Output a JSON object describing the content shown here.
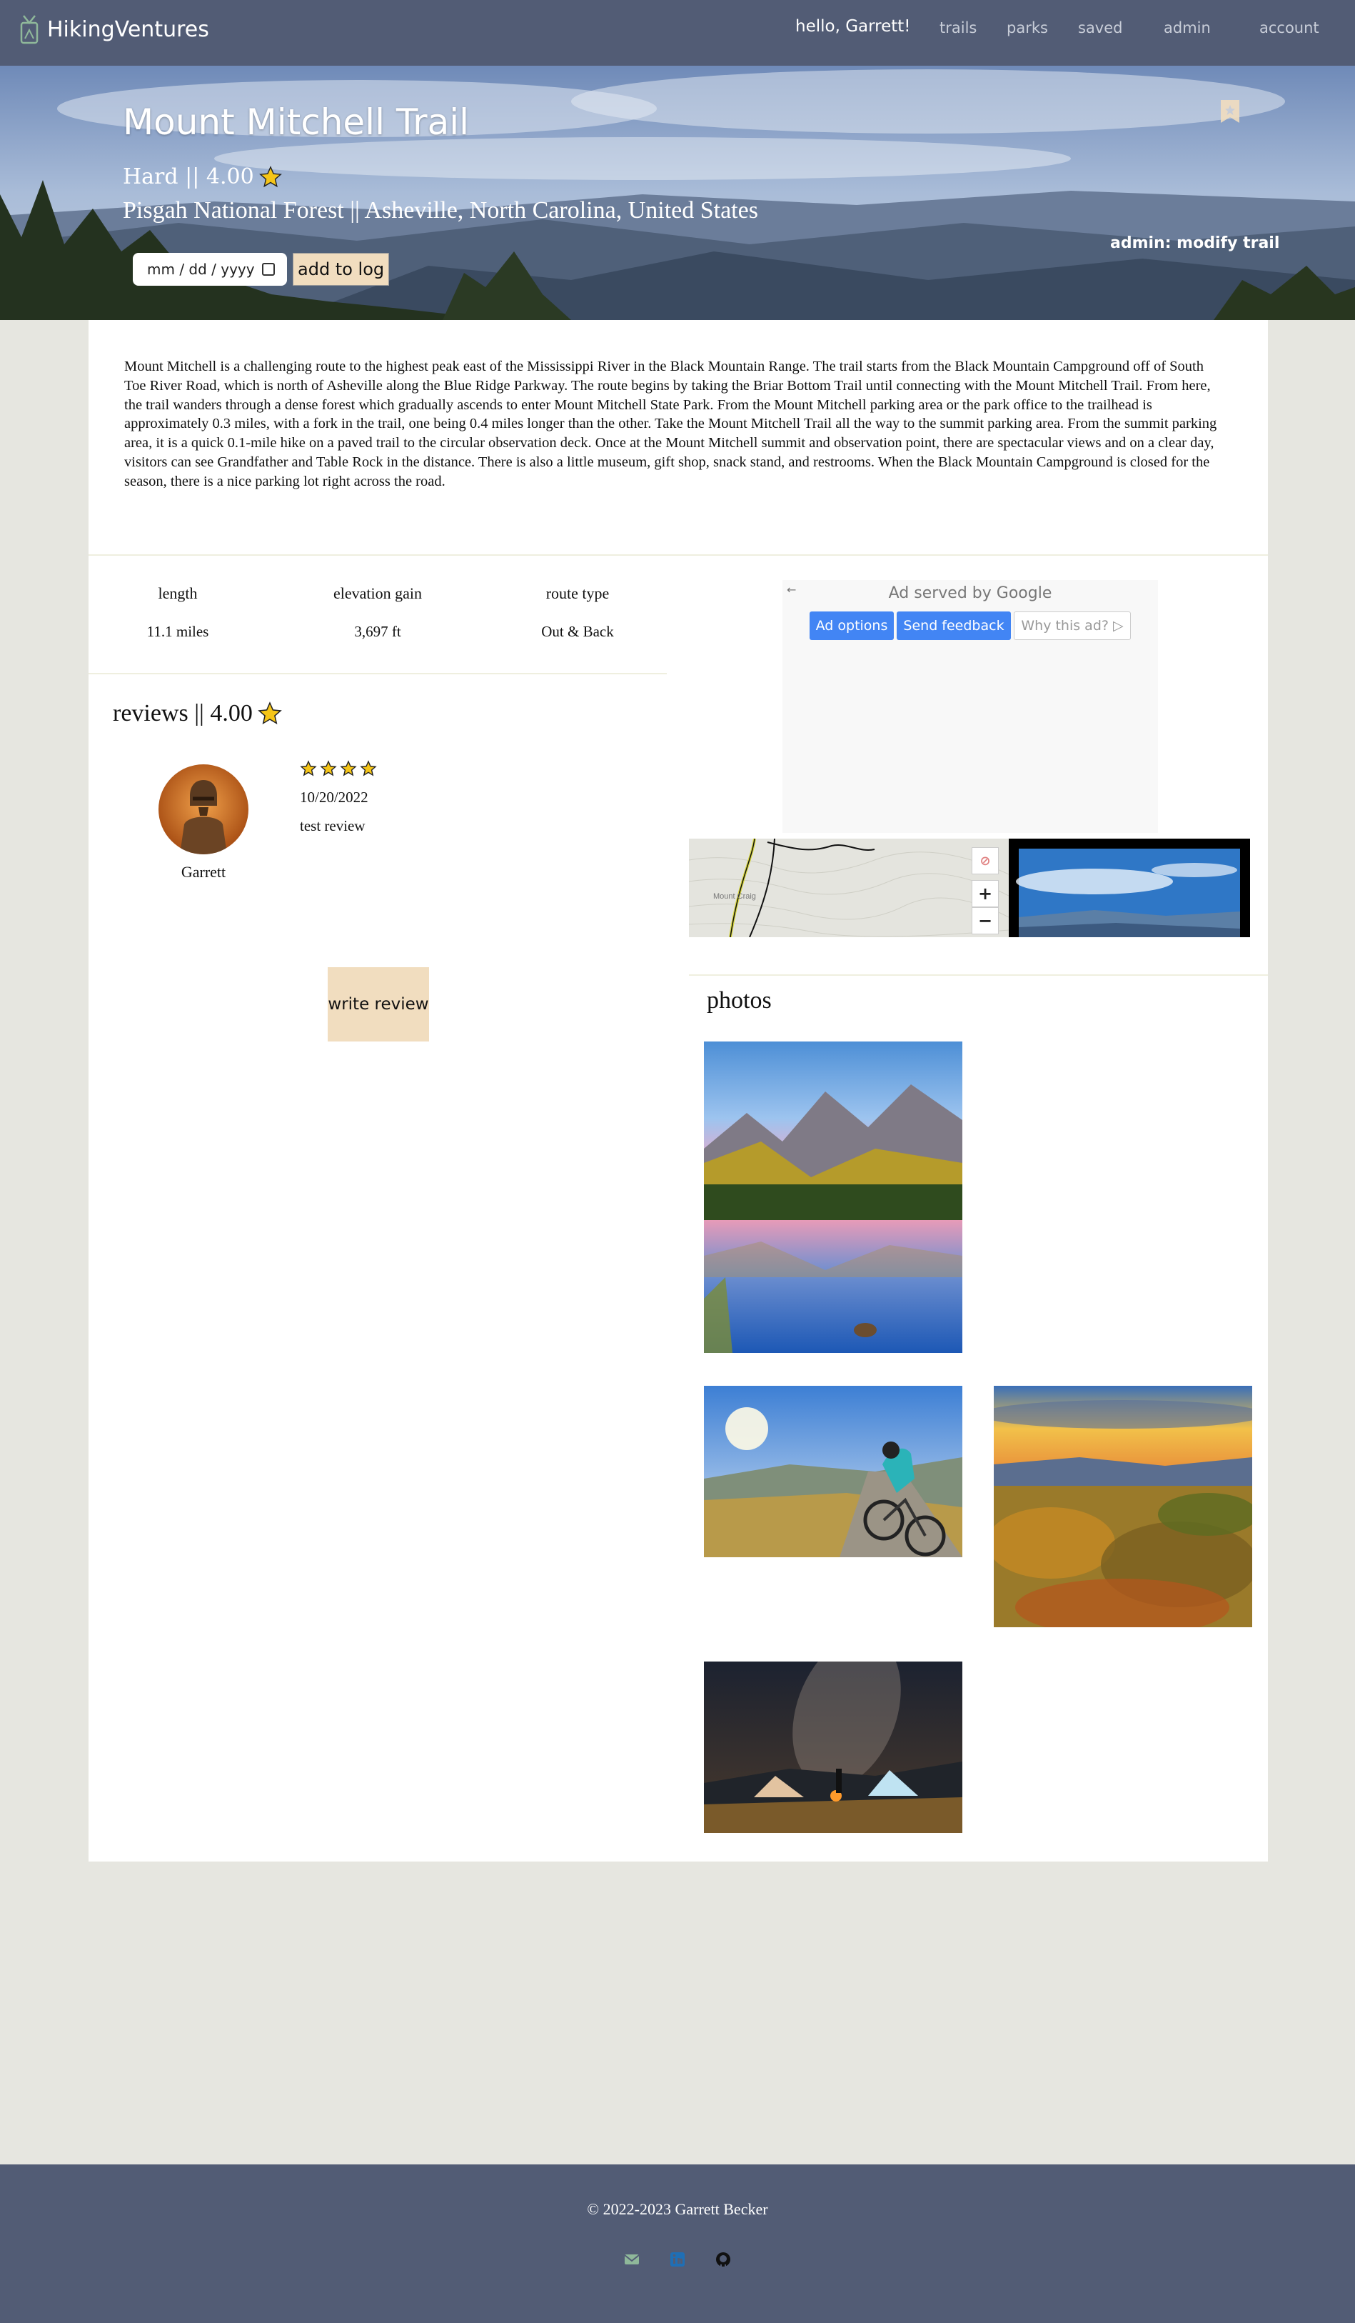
{
  "nav": {
    "brand": "HikingVentures",
    "greeting": "hello, Garrett!",
    "links": [
      "trails",
      "parks",
      "saved",
      "admin",
      "account"
    ]
  },
  "hero": {
    "title": "Mount Mitchell Trail",
    "difficulty_rating": "Hard || 4.00",
    "location": "Pisgah National Forest || Asheville, North Carolina, United States",
    "date_placeholder": "mm / dd / yyyy",
    "add_to_log": "add to log",
    "admin_link": "admin: modify trail"
  },
  "description": "Mount Mitchell is a challenging route to the highest peak east of the Mississippi River in the Black Mountain Range. The trail starts from the Black Mountain Campground off of South Toe River Road, which is north of Asheville along the Blue Ridge Parkway. The route begins by taking the Briar Bottom Trail until connecting with the Mount Mitchell Trail. From here, the trail wanders through a dense forest which gradually ascends to enter Mount Mitchell State Park. From the Mount Mitchell parking area or the park office to the trailhead is approximately 0.3 miles, with a fork in the trail, one being 0.4 miles longer than the other. Take the Mount Mitchell Trail all the way to the summit parking area. From the summit parking area, it is a quick 0.1-mile hike on a paved trail to the circular observation deck. Once at the Mount Mitchell summit and observation point, there are spectacular views and on a clear day, visitors can see Grandfather and Table Rock in the distance. There is also a little museum, gift shop, snack stand, and restrooms. When the Black Mountain Campground is closed for the season, there is a nice parking lot right across the road.",
  "stats": [
    {
      "label": "length",
      "value": "11.1 miles"
    },
    {
      "label": "elevation gain",
      "value": "3,697 ft"
    },
    {
      "label": "route type",
      "value": "Out & Back"
    }
  ],
  "reviews": {
    "title": "reviews || 4.00",
    "items": [
      {
        "user": "Garrett",
        "rating": 4,
        "date": "10/20/2022",
        "text": "test review"
      }
    ],
    "write_button": "write review"
  },
  "ad": {
    "served_by": "Ad served by Google",
    "options": "Ad options",
    "feedback": "Send feedback",
    "why": "Why this ad?"
  },
  "map": {
    "place_label": "Mount Craig",
    "zoom_in": "+",
    "zoom_out": "−"
  },
  "photos": {
    "title": "photos"
  },
  "footer": {
    "copyright": "© 2022-2023 Garrett Becker"
  },
  "colors": {
    "nav_bg": "#525c75",
    "accent": "#f1ddbf",
    "ad_blue": "#4285f4",
    "star": "#f5c518"
  }
}
